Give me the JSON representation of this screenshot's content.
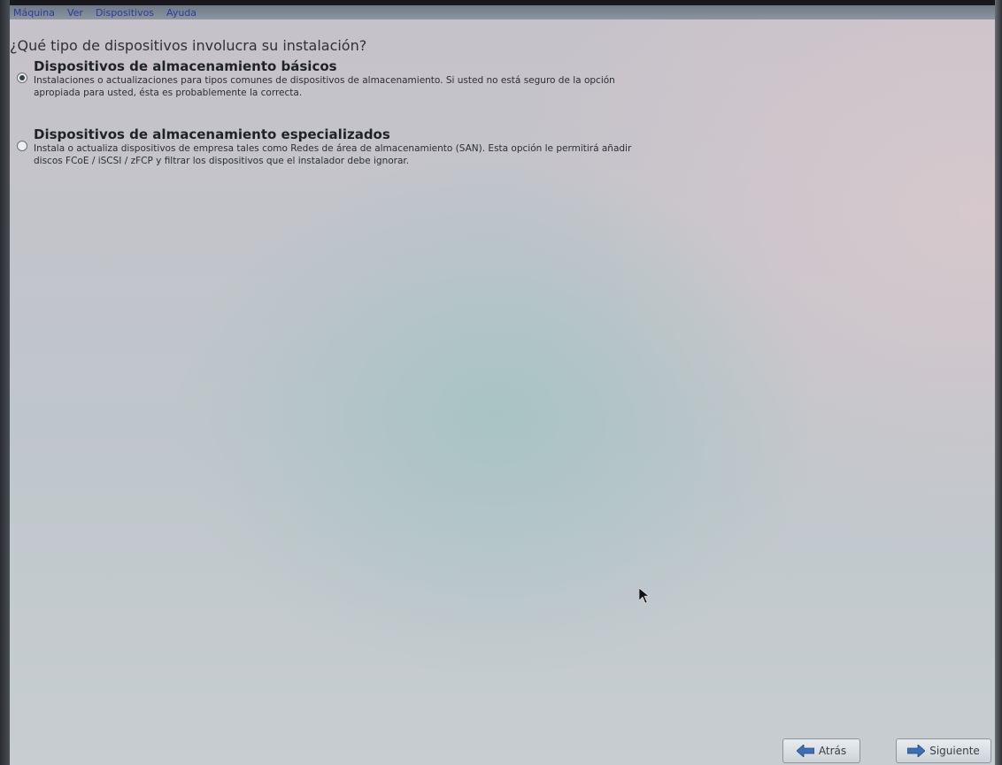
{
  "menubar": {
    "items": [
      "Máquina",
      "Ver",
      "Dispositivos",
      "Ayuda"
    ]
  },
  "installer": {
    "question": "¿Qué tipo de dispositivos involucra su instalación?",
    "options": [
      {
        "title": "Dispositivos de almacenamiento básicos",
        "description": "Instalaciones o actualizaciones para tipos comunes de dispositivos de almacenamiento. Si usted no está seguro de la opción apropiada para usted, ésta es probablemente la correcta.",
        "selected": true
      },
      {
        "title": "Dispositivos de almacenamiento especializados",
        "description": "Instala o actualiza dispositivos de empresa tales como Redes de área de almacenamiento (SAN). Esta opción le permitirá añadir discos FCoE / iSCSI / zFCP y filtrar los dispositivos que el instalador debe ignorar.",
        "selected": false
      }
    ],
    "buttons": {
      "back": "Atrás",
      "next": "Siguiente"
    }
  },
  "icons": {
    "back": "left-arrow-icon",
    "next": "right-arrow-icon",
    "cursor": "mouse-pointer-icon"
  },
  "colors": {
    "arrow": "#3b6fb6"
  }
}
